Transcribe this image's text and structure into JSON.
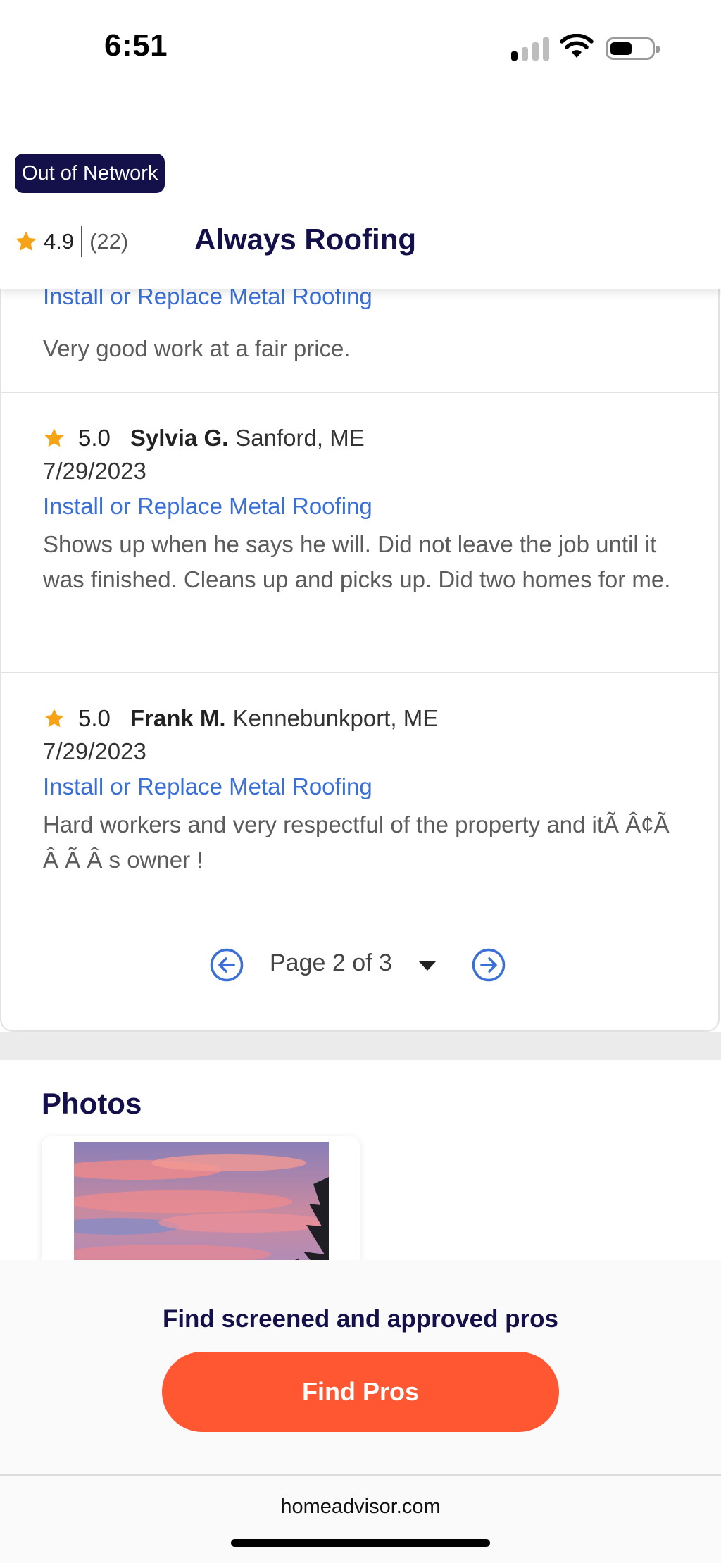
{
  "status_bar": {
    "time": "6:51"
  },
  "pro": {
    "badge": "Out of Network",
    "rating": "4.9",
    "review_count": "(22)",
    "name": "Always Roofing"
  },
  "reviews": [
    {
      "service": "Install or Replace Metal Roofing",
      "body": "Very good work at a fair price."
    },
    {
      "score": "5.0",
      "reviewer": "Sylvia G.",
      "location": "Sanford, ME",
      "date": "7/29/2023",
      "service": "Install or Replace Metal Roofing",
      "body": "Shows up when he says he will. Did not leave the job until it was finished. Cleans up and picks up. Did two homes for me."
    },
    {
      "score": "5.0",
      "reviewer": "Frank M.",
      "location": "Kennebunkport, ME",
      "date": "7/29/2023",
      "service": "Install or Replace Metal Roofing",
      "body": "Hard workers and very respectful of the property and itÃ Â¢Ã Â Ã Â s owner !"
    }
  ],
  "pagination": {
    "label": "Page 2 of 3"
  },
  "photos": {
    "title": "Photos"
  },
  "cta": {
    "text": "Find screened and approved pros",
    "button": "Find Pros"
  },
  "browser": {
    "url": "homeadvisor.com"
  },
  "colors": {
    "brand_navy": "#13104a",
    "accent_orange": "#fe5732",
    "link_blue": "#3a6fd8",
    "star": "#f6a316"
  }
}
